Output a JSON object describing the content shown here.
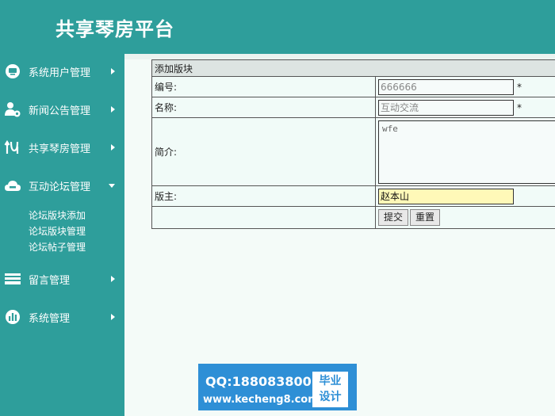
{
  "header": {
    "title": "共享琴房平台"
  },
  "sidebar": {
    "items": [
      {
        "label": "系统用户管理",
        "icon": "monitor-icon"
      },
      {
        "label": "新闻公告管理",
        "icon": "user-settings-icon"
      },
      {
        "label": "共享琴房管理",
        "icon": "swap-icon"
      },
      {
        "label": "互动论坛管理",
        "icon": "cloud-icon"
      },
      {
        "label": "留言管理",
        "icon": "stack-icon"
      },
      {
        "label": "系统管理",
        "icon": "bar-chart-icon"
      }
    ],
    "submenu": [
      "论坛版块添加",
      "论坛版块管理",
      "论坛帖子管理"
    ]
  },
  "form": {
    "caption": "添加版块",
    "fields": {
      "code": {
        "label": "编号:",
        "value": "666666",
        "required_mark": "*"
      },
      "name": {
        "label": "名称:",
        "value": "互动交流",
        "required_mark": "*"
      },
      "intro": {
        "label": "简介:",
        "value": "wfe"
      },
      "moderator": {
        "label": "版主:",
        "value": "赵本山"
      }
    },
    "buttons": {
      "submit": "提交",
      "reset": "重置"
    }
  },
  "watermark": {
    "qq": "QQ:188083800",
    "url": "www.kecheng8.com",
    "badge_line1": "毕业",
    "badge_line2": "设计"
  },
  "colors": {
    "theme": "#2e9e9b",
    "content_bg": "#f4fbf8",
    "active_field": "#fff9b8",
    "watermark_bg": "#2e8fd6"
  }
}
